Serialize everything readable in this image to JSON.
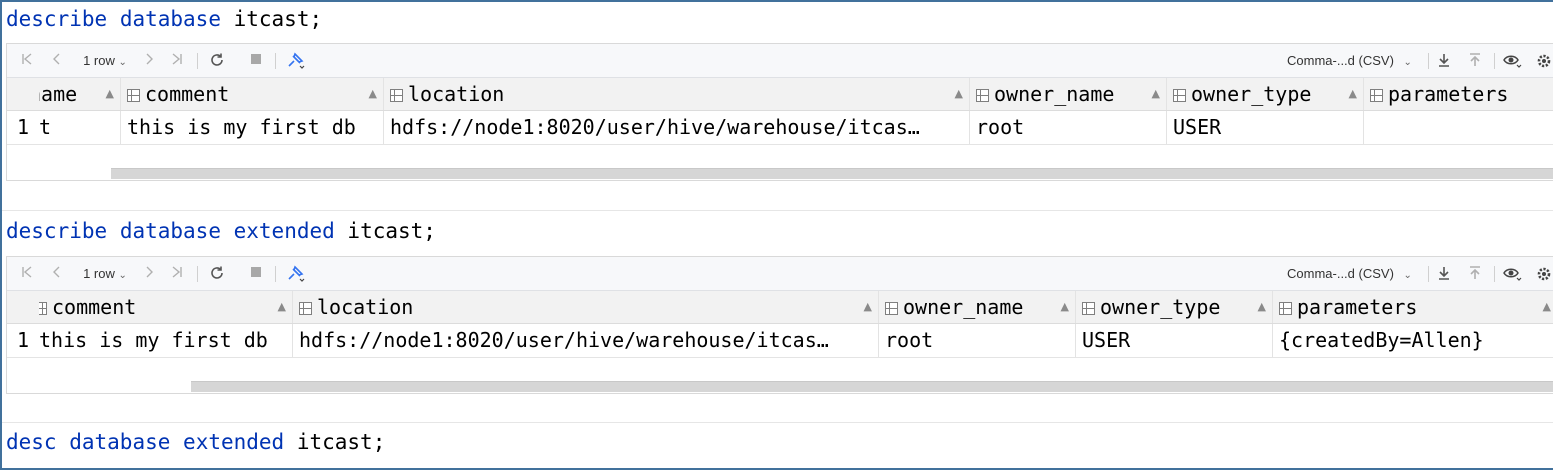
{
  "queries": [
    {
      "tokens": [
        {
          "kw": true,
          "t": "describe"
        },
        {
          "kw": false,
          "t": " "
        },
        {
          "kw": true,
          "t": "database"
        },
        {
          "kw": false,
          "t": " itcast;"
        }
      ]
    },
    {
      "tokens": [
        {
          "kw": true,
          "t": "describe"
        },
        {
          "kw": false,
          "t": " "
        },
        {
          "kw": true,
          "t": "database"
        },
        {
          "kw": false,
          "t": " "
        },
        {
          "kw": true,
          "t": "extended"
        },
        {
          "kw": false,
          "t": " itcast;"
        }
      ]
    },
    {
      "tokens": [
        {
          "kw": true,
          "t": "desc"
        },
        {
          "kw": false,
          "t": " "
        },
        {
          "kw": true,
          "t": "database"
        },
        {
          "kw": false,
          "t": " "
        },
        {
          "kw": true,
          "t": "extended"
        },
        {
          "kw": false,
          "t": " itcast;"
        }
      ]
    }
  ],
  "toolbar": {
    "row_count": "1 row",
    "export_format": "Comma-...d (CSV)",
    "icons": [
      "first-page-icon",
      "prev-page-icon",
      "next-page-icon",
      "last-page-icon",
      "refresh-icon",
      "stop-icon",
      "pin-icon",
      "download-icon",
      "upload-icon",
      "view-icon",
      "settings-icon"
    ]
  },
  "result1": {
    "columns": [
      "name",
      "comment",
      "location",
      "owner_name",
      "owner_type",
      "parameters"
    ],
    "row_number": "1",
    "row": [
      "t",
      "this is my first db",
      "hdfs://node1:8020/user/hive/warehouse/itcas…",
      "root",
      "USER",
      ""
    ]
  },
  "result2": {
    "columns": [
      "comment",
      "location",
      "owner_name",
      "owner_type",
      "parameters"
    ],
    "row_number": "1",
    "row": [
      "this is my first db",
      "hdfs://node1:8020/user/hive/warehouse/itcas…",
      "root",
      "USER",
      "{createdBy=Allen}"
    ]
  },
  "colors": {
    "keyword": "#0033b3",
    "frame_border": "#41719c"
  }
}
